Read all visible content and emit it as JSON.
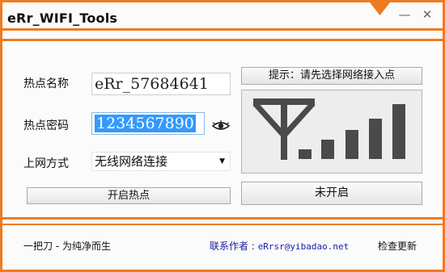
{
  "app": {
    "title": "eRr_WIFI_Tools"
  },
  "window_controls": {
    "menu_icon": "orange-down-triangle-icon",
    "minimize_label": "—",
    "close_label": "✕"
  },
  "form": {
    "hotspot_name_label": "热点名称",
    "hotspot_name_value": "eRr_57684641",
    "hotspot_password_label": "热点密码",
    "hotspot_password_value": "1234567890",
    "network_mode_label": "上网方式",
    "network_mode_value": "无线网络连接",
    "start_hotspot_label": "开启热点"
  },
  "status": {
    "hint": "提示：请先选择网络接入点",
    "state_label": "未开启",
    "signal_levels": 5
  },
  "footer": {
    "slogan": "一把刀 - 为纯净而生",
    "contact_label": "联系作者 : ",
    "contact_email": "eRrsr@yibadao.net",
    "check_update_label": "检查更新"
  },
  "colors": {
    "accent_orange": "#f07b1e",
    "contact_blue": "#1a1aa6"
  }
}
